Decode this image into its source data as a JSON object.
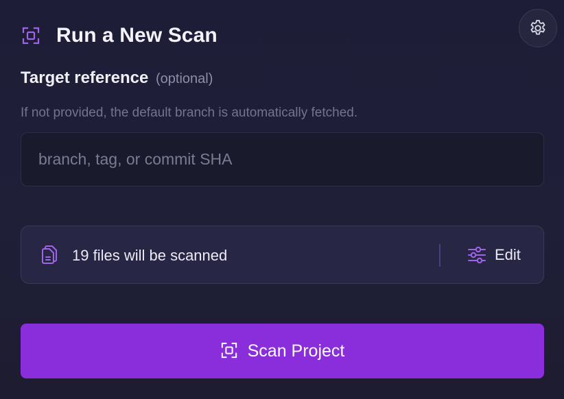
{
  "header": {
    "title": "Run a New Scan",
    "icon": "scan-frame-icon"
  },
  "settings": {
    "icon": "gear-icon"
  },
  "target": {
    "label": "Target reference",
    "optional_label": "(optional)",
    "help_text": "If not provided, the default branch is automatically fetched.",
    "input_value": "",
    "placeholder": "branch, tag, or commit SHA"
  },
  "files": {
    "icon": "files-icon",
    "summary": "19 files will be scanned",
    "edit_label": "Edit",
    "edit_icon": "sliders-icon"
  },
  "scan_button": {
    "label": "Scan Project",
    "icon": "scan-frame-icon"
  },
  "colors": {
    "accent": "#8a2ddb",
    "icon_accent": "#a064e8",
    "background": "#1f1e36"
  }
}
